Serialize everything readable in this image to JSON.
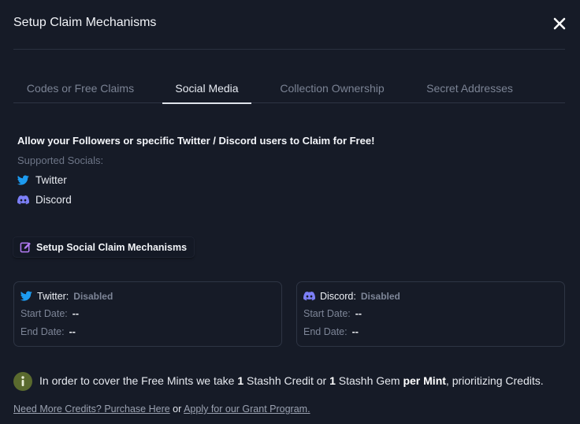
{
  "modal": {
    "title": "Setup Claim Mechanisms",
    "close_icon": "close-icon"
  },
  "tabs": [
    {
      "label": "Codes or Free Claims",
      "active": false
    },
    {
      "label": "Social Media",
      "active": true
    },
    {
      "label": "Collection Ownership",
      "active": false
    },
    {
      "label": "Secret Addresses",
      "active": false
    }
  ],
  "social_media": {
    "intro": "Allow your Followers or specific Twitter / Discord users to Claim for Free!",
    "supported_label": "Supported Socials:",
    "socials": [
      {
        "name": "Twitter",
        "icon": "twitter-icon"
      },
      {
        "name": "Discord",
        "icon": "discord-icon"
      }
    ],
    "setup_button": "Setup Social Claim Mechanisms",
    "setup_button_icon": "edit-icon",
    "cards": [
      {
        "name": "Twitter:",
        "status": "Disabled",
        "icon": "twitter-icon",
        "start_label": "Start Date:",
        "start_value": "--",
        "end_label": "End Date:",
        "end_value": "--"
      },
      {
        "name": "Discord:",
        "status": "Disabled",
        "icon": "discord-icon",
        "start_label": "Start Date:",
        "start_value": "--",
        "end_label": "End Date:",
        "end_value": "--"
      }
    ]
  },
  "notice": {
    "icon": "info-icon",
    "part1": "In order to cover the Free Mints we take ",
    "num1": "1",
    "part2": " Stashh Credit or ",
    "num2": "1",
    "part3": " Stashh Gem ",
    "per_mint": "per Mint",
    "part4": ", prioritizing Credits."
  },
  "links": {
    "credits": "Need More Credits? Purchase Here",
    "or": " or ",
    "grant": "Apply for our Grant Program."
  },
  "colors": {
    "background": "#161b27",
    "twitter": "#1d9bf0",
    "discord": "#7c7ff7",
    "edit_icon": "#b57cf6",
    "info_icon_bg": "#5a6a2e"
  }
}
